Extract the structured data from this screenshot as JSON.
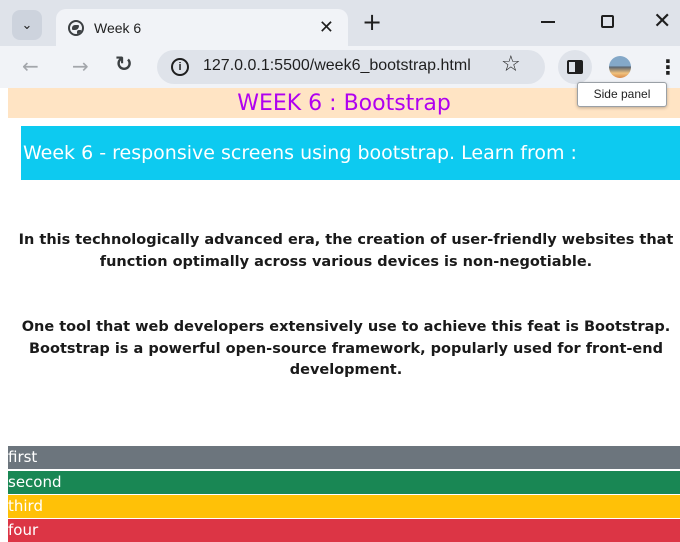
{
  "browser": {
    "tab_title": "Week 6",
    "url": "127.0.0.1:5500/week6_bootstrap.html",
    "tooltip": "Side panel",
    "icons": {
      "tab_search": "chevron-down-icon",
      "favicon": "globe-icon",
      "tab_close": "close-icon",
      "new_tab": "plus-icon",
      "back": "arrow-left-icon",
      "forward": "arrow-right-icon",
      "reload": "reload-icon",
      "site_info": "info-icon",
      "bookmark": "star-icon",
      "side_panel": "side-panel-icon",
      "menu": "kebab-menu-icon"
    }
  },
  "page": {
    "heading": "WEEK 6 : Bootstrap",
    "hero_text": "Week 6 - responsive screens using bootstrap. Learn from :",
    "paragraph1": "In this technologically advanced era, the creation of user-friendly websites that function optimally across various devices is non-negotiable.",
    "paragraph2": "One tool that web developers extensively use to achieve this feat is Bootstrap. Bootstrap is a powerful open-source framework, popularly used for front-end development.",
    "bars": [
      {
        "label": "first",
        "color": "#6c757d"
      },
      {
        "label": "second",
        "color": "#198754"
      },
      {
        "label": "third",
        "color": "#ffc107"
      },
      {
        "label": "four",
        "color": "#dc3545"
      }
    ]
  },
  "colors": {
    "heading_bg": "#ffe4c4",
    "heading_text": "#b000f0",
    "hero_bg": "#0dcaf0"
  }
}
